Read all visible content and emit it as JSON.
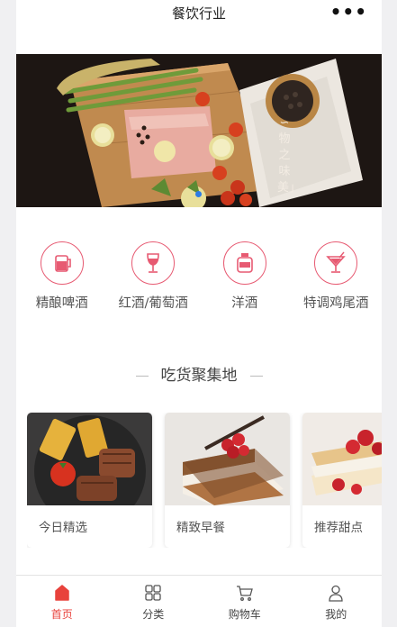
{
  "header": {
    "title": "餐饮行业",
    "more_label": "•••"
  },
  "banner": {
    "caption": "∽物之味美」",
    "active_slide": 1,
    "slide_count": 1
  },
  "categories": [
    {
      "label": "精酿啤酒",
      "icon": "beer-glass-icon"
    },
    {
      "label": "红酒/葡萄酒",
      "icon": "wine-glass-icon"
    },
    {
      "label": "洋酒",
      "icon": "liquor-bottle-icon"
    },
    {
      "label": "特调鸡尾酒",
      "icon": "cocktail-glass-icon"
    }
  ],
  "section": {
    "title": "吃货聚集地"
  },
  "cards": [
    {
      "label": "今日精选",
      "image": "steak-plate-photo"
    },
    {
      "label": "精致早餐",
      "image": "tiramisu-cake-photo"
    },
    {
      "label": "推荐甜点",
      "image": "strawberry-pastry-photo"
    }
  ],
  "tabbar": {
    "active_index": 0,
    "items": [
      {
        "label": "首页",
        "icon": "home-icon"
      },
      {
        "label": "分类",
        "icon": "grid-icon"
      },
      {
        "label": "购物车",
        "icon": "cart-icon"
      },
      {
        "label": "我的",
        "icon": "user-icon"
      }
    ]
  },
  "colors": {
    "accent": "#e75a72",
    "active_tab": "#e8423c",
    "indicator": "#2d7be5"
  }
}
